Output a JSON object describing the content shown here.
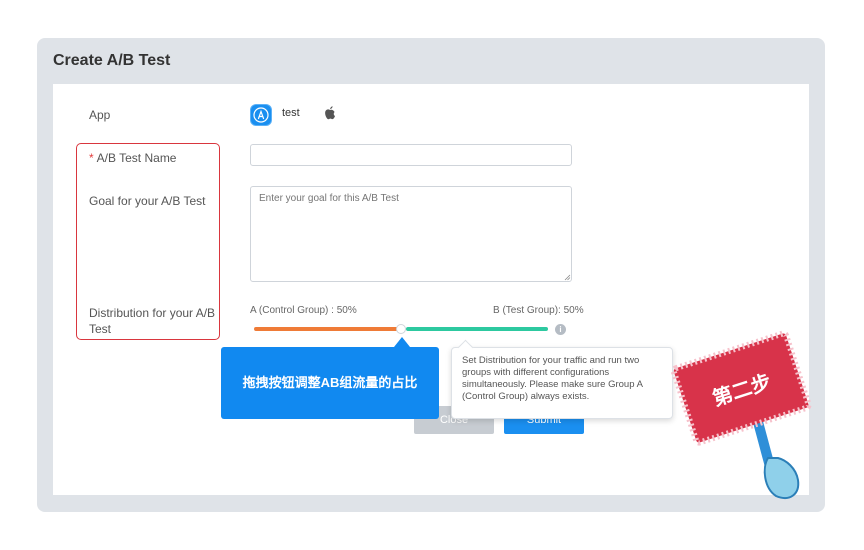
{
  "dialog": {
    "title": "Create A/B Test"
  },
  "form": {
    "app": {
      "label": "App",
      "name": "test",
      "icon": "app-store-icon",
      "platform_icon": "apple-icon"
    },
    "name_field": {
      "required_mark": "*",
      "label": "A/B Test Name",
      "value": ""
    },
    "goal_field": {
      "label": "Goal for your A/B Test",
      "placeholder": "Enter your goal for this A/B Test"
    },
    "distribution": {
      "label": "Distribution for your A/B Test",
      "group_a_label": "A (Control Group) : 50%",
      "group_b_label": "B (Test Group): 50%",
      "group_a_share": 50,
      "group_b_share": 50,
      "info_icon": "i"
    }
  },
  "tooltip": {
    "text": "Set Distribution for your traffic and run two groups with different configurations simultaneously. Please make sure Group A (Control Group) always exists."
  },
  "buttons": {
    "close": "Close",
    "submit": "Submit"
  },
  "annotations": {
    "callout": "拖拽按钮调整AB组流量的占比",
    "step_sign": "第二步"
  },
  "colors": {
    "accent": "#1a8ff0",
    "group_a": "#ef7b37",
    "group_b": "#2dc9a0",
    "highlight": "#d9363e",
    "sign_red": "#d8334a"
  }
}
